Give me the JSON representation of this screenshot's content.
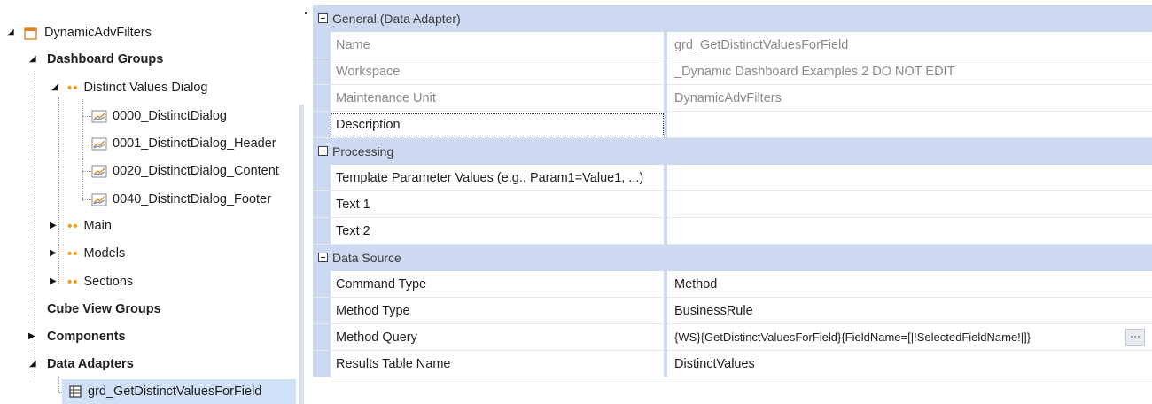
{
  "tree": {
    "root": "DynamicAdvFilters",
    "dashboard_groups": "Dashboard Groups",
    "distinct_values_dialog": "Distinct Values Dialog",
    "dashboards": [
      "0000_DistinctDialog",
      "0001_DistinctDialog_Header",
      "0020_DistinctDialog_Content",
      "0040_DistinctDialog_Footer"
    ],
    "main": "Main",
    "models": "Models",
    "sections": "Sections",
    "cube_view_groups": "Cube View Groups",
    "components": "Components",
    "data_adapters": "Data Adapters",
    "selected_adapter": "grd_GetDistinctValuesForField"
  },
  "grid": {
    "general": {
      "title": "General (Data Adapter)",
      "name_label": "Name",
      "name_value": "grd_GetDistinctValuesForField",
      "workspace_label": "Workspace",
      "workspace_value": "_Dynamic Dashboard Examples 2 DO NOT EDIT",
      "maintenance_unit_label": "Maintenance Unit",
      "maintenance_unit_value": "DynamicAdvFilters",
      "description_label": "Description",
      "description_value": ""
    },
    "processing": {
      "title": "Processing",
      "template_params_label": "Template Parameter Values (e.g., Param1=Value1, ...)",
      "text1_label": "Text 1",
      "text2_label": "Text 2"
    },
    "data_source": {
      "title": "Data Source",
      "command_type_label": "Command Type",
      "command_type_value": "Method",
      "method_type_label": "Method Type",
      "method_type_value": "BusinessRule",
      "method_query_label": "Method Query",
      "method_query_value": "{WS}{GetDistinctValuesForField}{FieldName=[|!SelectedFieldName!|]}",
      "results_table_label": "Results Table Name",
      "results_table_value": "DistinctValues",
      "ellipsis": "···"
    }
  },
  "colors": {
    "category_band": "#cdd9f0",
    "selection": "#cfe0f7",
    "group_dots": "#f0a020",
    "readonly_text": "#8a8a8a"
  }
}
